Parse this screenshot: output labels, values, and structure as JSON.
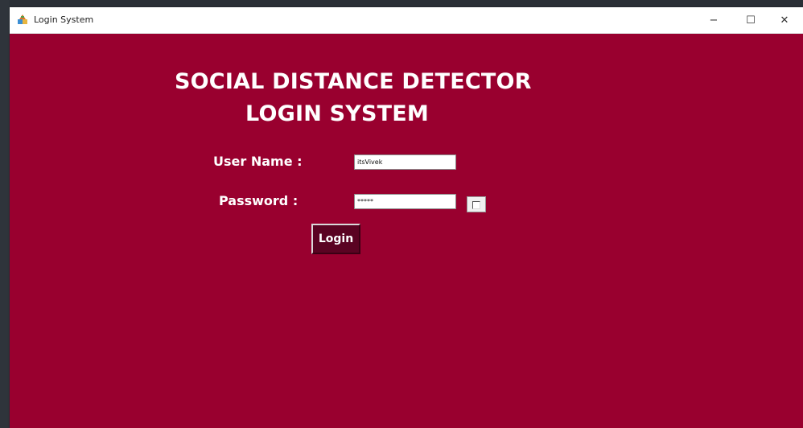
{
  "window": {
    "title": "Login System",
    "controls": {
      "minimize": "−",
      "maximize": "☐",
      "close": "✕"
    },
    "background": "#99002f"
  },
  "heading": {
    "line1": "SOCIAL DISTANCE DETECTOR",
    "line2": "LOGIN SYSTEM"
  },
  "form": {
    "username_label": "User Name :",
    "username_value": "itsVivek",
    "password_label": "Password  :",
    "password_value": "*****",
    "show_password_checked": false,
    "login_button": "Login",
    "login_button_color": "#5a0322"
  }
}
